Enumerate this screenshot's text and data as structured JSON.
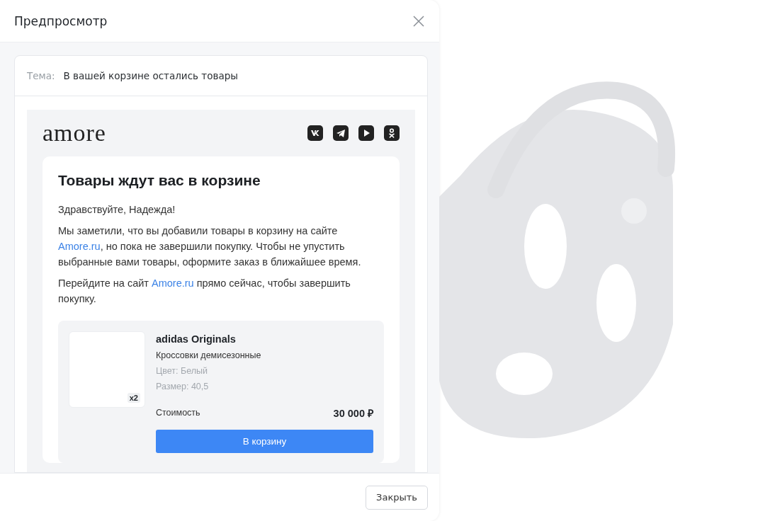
{
  "dialog": {
    "title": "Предпросмотр"
  },
  "subject": {
    "label": "Тема:",
    "value": "В вашей корзине остались товары"
  },
  "email": {
    "logo": "amore",
    "heading": "Товары ждут вас в корзине",
    "greeting": "Здравствуйте, Надежда!",
    "paragraphs": [
      {
        "parts": [
          {
            "kind": "text",
            "text": "Мы заметили, что вы добавили товары в корзину на сайте "
          },
          {
            "kind": "link",
            "text": "Amore.ru"
          },
          {
            "kind": "text",
            "text": ", но пока не завершили покупку. Чтобы не упустить выбранные вами товары, оформите заказ в ближайшее время."
          }
        ]
      },
      {
        "parts": [
          {
            "kind": "text",
            "text": "Перейдите на сайт "
          },
          {
            "kind": "link",
            "text": "Amore.ru"
          },
          {
            "kind": "text",
            "text": " прямо сейчас, чтобы завершить покупку."
          }
        ]
      }
    ],
    "product": {
      "quantity": "x2",
      "brand": "adidas Originals",
      "name": "Кроссовки демисезонные",
      "attributes": [
        "Цвет: Белый",
        "Размер: 40,5"
      ],
      "price_label": "Стоимость",
      "price": "30 000 ₽",
      "button": "В корзину"
    }
  },
  "footer": {
    "close_button": "Закрыть"
  }
}
